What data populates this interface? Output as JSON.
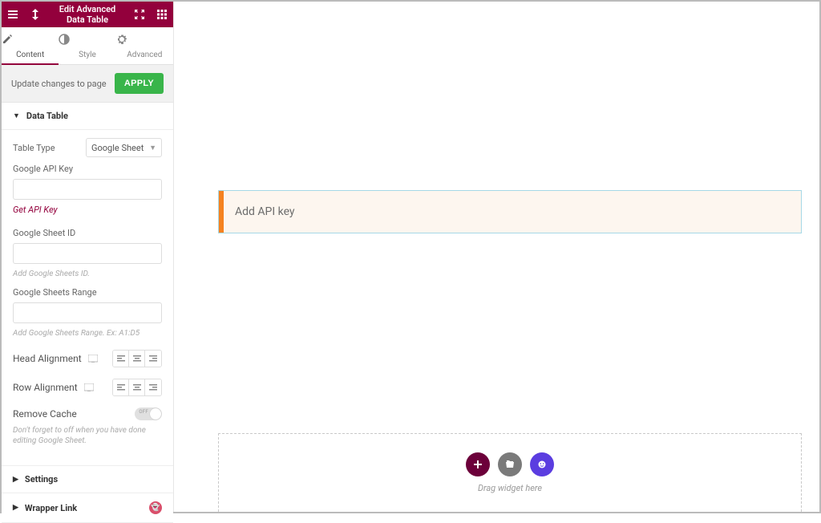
{
  "header": {
    "title": "Edit Advanced\nData Table"
  },
  "tabs": {
    "content": "Content",
    "style": "Style",
    "advanced": "Advanced"
  },
  "update_bar": {
    "text": "Update changes to page",
    "apply": "APPLY"
  },
  "sections": {
    "data_table": {
      "title": "Data Table",
      "table_type": {
        "label": "Table Type",
        "value": "Google Sheet"
      },
      "api_key": {
        "label": "Google API Key",
        "value": "",
        "get_link": "Get API Key"
      },
      "sheet_id": {
        "label": "Google Sheet ID",
        "value": "",
        "hint": "Add Google Sheets ID."
      },
      "sheets_range": {
        "label": "Google Sheets Range",
        "value": "",
        "hint": "Add Google Sheets Range. Ex: A1:D5"
      },
      "head_align": {
        "label": "Head Alignment"
      },
      "row_align": {
        "label": "Row Alignment"
      },
      "remove_cache": {
        "label": "Remove Cache",
        "state": "OFF",
        "hint": "Don't forget to off when you have done editing Google Sheet."
      }
    },
    "settings": {
      "title": "Settings"
    },
    "wrapper_link": {
      "title": "Wrapper Link"
    }
  },
  "canvas": {
    "notice": "Add API key",
    "dropzone": {
      "text": "Drag widget here"
    }
  }
}
